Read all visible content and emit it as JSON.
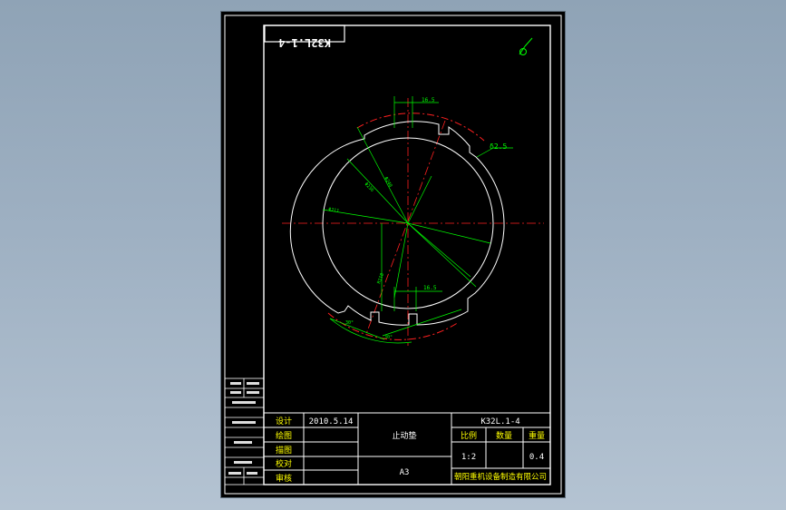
{
  "title_block": {
    "drawing_number": "K32L.1-4",
    "drawing_number_mirrored": "K32L.1-4",
    "part_name": "止动垫",
    "sheet_size": "A3",
    "company": "朝阳重机设备制造有限公司",
    "date": "2010.5.14",
    "scale_label": "比例",
    "scale_value": "1:2",
    "quantity_label": "数量",
    "weight_label": "重量",
    "weight_value": "0.4",
    "roles": [
      "设计",
      "绘图",
      "描图",
      "校对",
      "审核"
    ]
  },
  "dimensions": {
    "slot_width_top": "16.5",
    "slot_width_bottom": "16.5",
    "thickness": "δ2.5",
    "dia_outer": "Φ240",
    "dia_mid": "Φ236",
    "dia_inner": "Φ211",
    "radial": "R118",
    "angle_1": "30°",
    "angle_2": "30°"
  },
  "roughness_symbol": "▽",
  "colors": {
    "line": "#ffffff",
    "centerline": "#ff2020",
    "dimension": "#00ff00",
    "frame": "#ffffff",
    "text_yellow": "#ffff00"
  }
}
